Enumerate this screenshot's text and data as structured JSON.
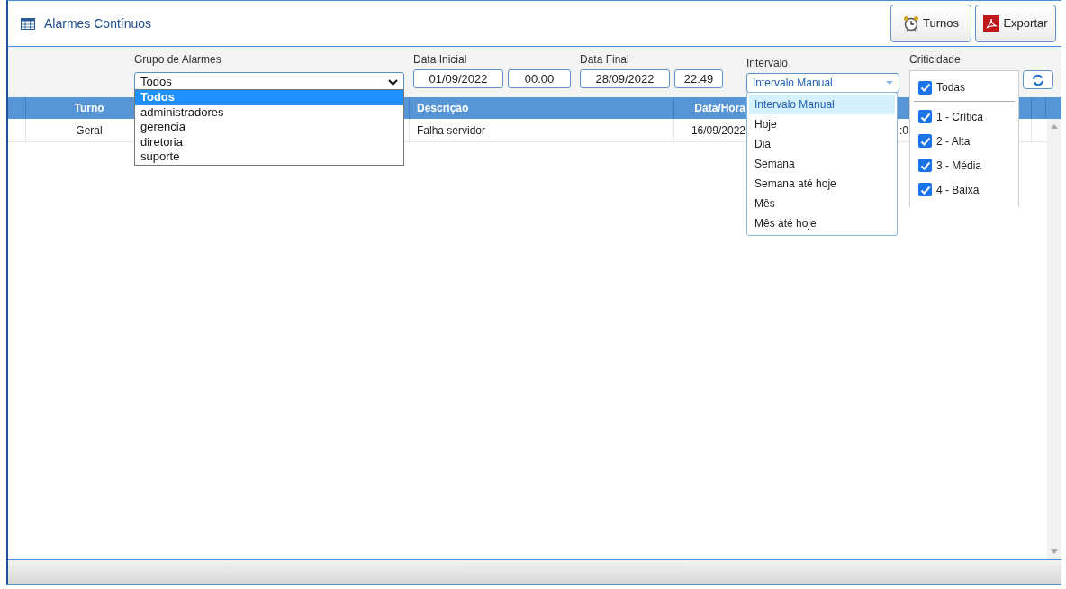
{
  "header": {
    "title": "Alarmes Contínuos",
    "buttons": [
      {
        "kind": "clock",
        "label": "Turnos"
      },
      {
        "kind": "pdf",
        "label": "Exportar"
      }
    ]
  },
  "filters": {
    "group": {
      "label": "Grupo de Alarmes",
      "value": "Todos",
      "expanded": true,
      "options": [
        {
          "label": "Todos",
          "selected": true
        },
        {
          "label": "administradores",
          "selected": false
        },
        {
          "label": "gerencia",
          "selected": false
        },
        {
          "label": "diretoria",
          "selected": false
        },
        {
          "label": "suporte",
          "selected": false
        }
      ]
    },
    "start": {
      "label": "Data Inicial",
      "date": "01/09/2022",
      "time": "00:00"
    },
    "end": {
      "label": "Data Final",
      "date": "28/09/2022",
      "time": "22:49"
    },
    "interval": {
      "label": "Intervalo",
      "value": "Intervalo Manual",
      "expanded": true,
      "options": [
        {
          "label": "Intervalo Manual",
          "selected": true
        },
        {
          "label": "Hoje",
          "selected": false
        },
        {
          "label": "Dia",
          "selected": false
        },
        {
          "label": "Semana",
          "selected": false
        },
        {
          "label": "Semana até hoje",
          "selected": false
        },
        {
          "label": "Mês",
          "selected": false
        },
        {
          "label": "Mês até hoje",
          "selected": false
        }
      ]
    },
    "criticality": {
      "label": "Criticidade",
      "all": {
        "label": "Todas",
        "checked": true
      },
      "options": [
        {
          "label": "1 - Crítica",
          "checked": true
        },
        {
          "label": "2 - Alta",
          "checked": true
        },
        {
          "label": "3 - Média",
          "checked": true
        },
        {
          "label": "4 - Baixa",
          "checked": true
        }
      ]
    }
  },
  "table": {
    "columns": [
      "Turno",
      "Descrição",
      "Data/Hora"
    ],
    "rows": [
      [
        "Geral",
        "Falha servidor",
        "16/09/2022",
        ":0"
      ]
    ]
  }
}
